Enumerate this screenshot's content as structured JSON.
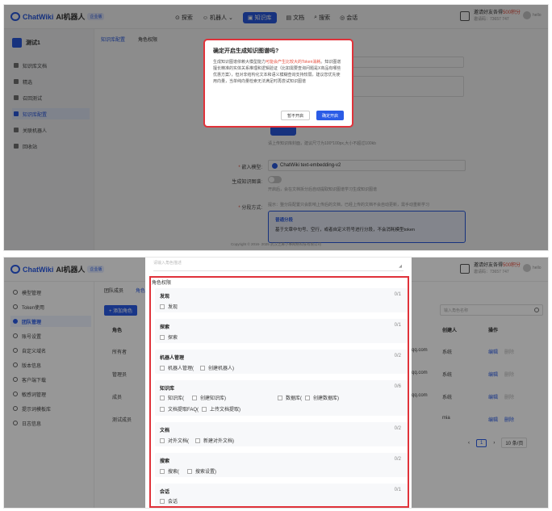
{
  "top": {
    "logo_brand": "ChatWiki",
    "logo_sub": "AI机器人",
    "version": "企业版",
    "nav": [
      {
        "label": "探索"
      },
      {
        "label": "机器人"
      },
      {
        "label": "知识库"
      },
      {
        "label": "文档"
      },
      {
        "label": "搜索"
      },
      {
        "label": "会话"
      }
    ],
    "invite_pre": "邀请好友各得",
    "invite_hl": "500积分",
    "invite_id": "邀请码：73657 747",
    "user": "hello"
  },
  "panel1": {
    "kb_name": "测试1",
    "tabs": [
      "知识库配置",
      "角色权限"
    ],
    "sidebar": [
      {
        "label": "知识库文档"
      },
      {
        "label": "精选"
      },
      {
        "label": "召回测试"
      },
      {
        "label": "知识库配置"
      },
      {
        "label": "关联机器人"
      },
      {
        "label": "回收站"
      }
    ],
    "modal": {
      "title": "确定开启生成知识图谱吗?",
      "body_pre": "生成知识图谱依赖大模型能力",
      "body_red": "可能会产生比较大的Token消耗",
      "body_post": "。知识图谱擅长精准的实体关系推理和逻辑验证（比如需要查询问题是X商品有哪些优惠方案），但对非结构化文本和语义模糊查询支持较弱，建议您优先使用向量，当单纯向量检索无法满足时再尝试知识图谱",
      "cancel": "暂不开启",
      "confirm": "确定开启"
    },
    "upload_hint": "请上传知识库封面，建议尺寸为100*100px,大小不超过100kb",
    "embedding_label": "嵌入模型:",
    "embedding_value": "ChatWiki text-embedding-v2",
    "graph_label": "生成知识图谱:",
    "graph_hint": "开启后，会在文档拆分后自动提取知识图谱学习生成知识图谱",
    "split_label": "分段方式:",
    "split_hint": "提示：整分段配置只会影响上传后的文档，已经上传的文档不会自动更新，需手动重新学习",
    "split_card_title": "普通分段",
    "split_card_desc": "基于文章中句号、空行，或者自定义符号进行分段，不会消耗模型token",
    "footer": "Copyright © 2016- 2025 武汉芝麻小事网络科技有限公司"
  },
  "panel2": {
    "sidebar": [
      {
        "label": "模型管理"
      },
      {
        "label": "Token使用"
      },
      {
        "label": "团队管理"
      },
      {
        "label": "账号设置"
      },
      {
        "label": "自定义域名"
      },
      {
        "label": "版本信息"
      },
      {
        "label": "客户端下载"
      },
      {
        "label": "敏感词管理"
      },
      {
        "label": "提示词模板库"
      },
      {
        "label": "日志信息"
      }
    ],
    "tabs": [
      "团队成员",
      "角色"
    ],
    "add_role": "+ 添加角色",
    "search_placeholder": "输入角色名称",
    "col_role": "角色",
    "col_creator": "创建人",
    "col_action": "操作",
    "rows": [
      {
        "role": "所有者",
        "email": "qq.com",
        "creator": "系统",
        "edit": "编辑",
        "del": "删除"
      },
      {
        "role": "管理员",
        "email": "qq.com",
        "creator": "系统",
        "edit": "编辑",
        "del": "删除"
      },
      {
        "role": "成员",
        "email": "qq.com",
        "creator": "系统",
        "edit": "编辑",
        "del": "删除"
      },
      {
        "role": "测试成员",
        "email": "",
        "creator": "mia",
        "edit": "编辑",
        "del": "删除"
      }
    ],
    "pager_page": "1",
    "pager_size": "10 条/页",
    "drawer": {
      "top_placeholder": "请输入角色描述",
      "section_title": "角色权限",
      "groups": [
        {
          "title": "发现",
          "count": "0/1",
          "items": [
            "发现"
          ]
        },
        {
          "title": "探索",
          "count": "0/1",
          "items": [
            "探索"
          ]
        },
        {
          "title": "机器人管理",
          "count": "0/2",
          "items": [
            "机器人管理(",
            "创建机器人)"
          ]
        },
        {
          "title": "知识库",
          "count": "0/6",
          "items": [
            "知识库(",
            "创建知识库)",
            "数据库(",
            "创建数据库)",
            "文档提取FAQ(",
            "上传文档提取)"
          ]
        },
        {
          "title": "文档",
          "count": "0/2",
          "items": [
            "对外文档(",
            "新建对外文档)"
          ]
        },
        {
          "title": "搜索",
          "count": "0/2",
          "items": [
            "搜索(",
            "搜索设置)"
          ]
        },
        {
          "title": "会话",
          "count": "0/1",
          "items": [
            "会话"
          ]
        }
      ]
    }
  }
}
